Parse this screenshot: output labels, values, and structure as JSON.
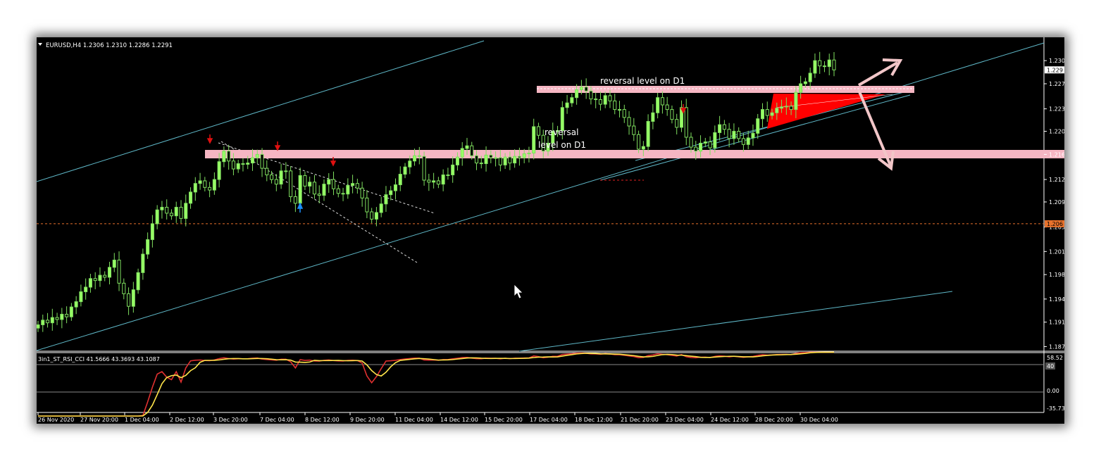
{
  "chart_header": {
    "symbol_line": "EURUSD,H4  1.2306 1.2310 1.2286 1.2291"
  },
  "annotations": {
    "upper_level": "reversal level on D1",
    "lower_level_line1": "reversal",
    "lower_level_line2": "level on D1"
  },
  "indicator": {
    "name": "3in1_ST_RSI_CCI 41.5666 43.3693 43.1087",
    "levels": [
      "58.52",
      "40",
      "0.00",
      "-35.73"
    ]
  },
  "colors": {
    "background": "#000000",
    "bull_candle": "#99ff66",
    "bear_candle": "#000000",
    "wick": "#7fdf5f",
    "channel_line": "#5fb8c8",
    "level_zone": "#f6b6c3",
    "price_line": "#e8722c",
    "signal_down": "#e01010",
    "signal_up": "#1a8fff",
    "arrow": "#f2c6c8",
    "rsi_line": "#e03030",
    "signal_line": "#ffe44a"
  },
  "chart_data": {
    "type": "candlestick",
    "symbol": "EURUSD",
    "timeframe": "H4",
    "last_ohlc": {
      "open": 1.2306,
      "high": 1.231,
      "low": 1.2286,
      "close": 1.2291
    },
    "y_ticks": [
      "1.230",
      "1.227",
      "1.223",
      "1.220",
      "1.216",
      "1.212",
      "1.209",
      "1.205",
      "1.201",
      "1.198",
      "1.194",
      "1.191",
      "1.187"
    ],
    "y_tick_values": [
      1.2305,
      1.227,
      1.2232,
      1.2198,
      1.2163,
      1.2125,
      1.2091,
      1.2053,
      1.2016,
      1.1981,
      1.1944,
      1.1909,
      1.1872
    ],
    "current_price_label": "1.229",
    "current_price": 1.2291,
    "marker_price_label": "1.206",
    "marker_price": 1.2058,
    "ylim": [
      1.1865,
      1.2335
    ],
    "x_ticks": [
      "26 Nov 2020",
      "27 Nov 20:00",
      "1 Dec 04:00",
      "2 Dec 12:00",
      "3 Dec 20:00",
      "7 Dec 04:00",
      "8 Dec 12:00",
      "9 Dec 20:00",
      "11 Dec 04:00",
      "14 Dec 12:00",
      "15 Dec 20:00",
      "17 Dec 04:00",
      "18 Dec 12:00",
      "21 Dec 20:00",
      "23 Dec 04:00",
      "24 Dec 12:00",
      "28 Dec 20:00",
      "30 Dec 04:00"
    ],
    "closes": [
      1.1905,
      1.1912,
      1.1908,
      1.1916,
      1.1913,
      1.1921,
      1.1917,
      1.1932,
      1.194,
      1.1955,
      1.1962,
      1.1975,
      1.1972,
      1.198,
      1.1977,
      1.1992,
      1.2003,
      1.1968,
      1.1952,
      1.1933,
      1.1958,
      1.1984,
      1.2012,
      1.2034,
      1.2058,
      1.2079,
      1.2083,
      1.2074,
      1.207,
      1.2083,
      1.2066,
      1.2089,
      1.2106,
      1.2119,
      1.2123,
      1.2113,
      1.2109,
      1.2125,
      1.2152,
      1.2168,
      1.2153,
      1.2141,
      1.2149,
      1.2148,
      1.215,
      1.2158,
      1.2163,
      1.2142,
      1.2132,
      1.2125,
      1.2118,
      1.2138,
      1.2138,
      1.2099,
      1.2089,
      1.2131,
      1.2115,
      1.2121,
      1.2103,
      1.2101,
      1.2118,
      1.2125,
      1.2111,
      1.2104,
      1.2103,
      1.2116,
      1.2119,
      1.2112,
      1.2097,
      1.2076,
      1.2065,
      1.2075,
      1.2088,
      1.2102,
      1.2108,
      1.2117,
      1.2133,
      1.2144,
      1.2153,
      1.2161,
      1.216,
      1.2124,
      1.2121,
      1.2123,
      1.2118,
      1.2132,
      1.2132,
      1.2147,
      1.2159,
      1.2172,
      1.2176,
      1.2161,
      1.215,
      1.2149,
      1.2162,
      1.2158,
      1.2158,
      1.2147,
      1.2159,
      1.215,
      1.216,
      1.2158,
      1.2164,
      1.2165,
      1.2205,
      1.2192,
      1.2168,
      1.218,
      1.2198,
      1.2199,
      1.2234,
      1.2241,
      1.2249,
      1.2261,
      1.2265,
      1.2259,
      1.2247,
      1.2246,
      1.2239,
      1.2252,
      1.2244,
      1.2231,
      1.2231,
      1.2219,
      1.2206,
      1.2193,
      1.2171,
      1.2175,
      1.2213,
      1.2226,
      1.2249,
      1.2238,
      1.2231,
      1.2216,
      1.2204,
      1.2234,
      1.2189,
      1.2174,
      1.2168,
      1.218,
      1.2182,
      1.2173,
      1.2196,
      1.2208,
      1.2201,
      1.2187,
      1.2198,
      1.2187,
      1.2178,
      1.2188,
      1.2195,
      1.2217,
      1.2231,
      1.2222,
      1.2226,
      1.2233,
      1.2235,
      1.2236,
      1.2231,
      1.2257,
      1.227,
      1.2273,
      1.2286,
      1.2305,
      1.2297,
      1.2296,
      1.2306,
      1.2291
    ]
  }
}
